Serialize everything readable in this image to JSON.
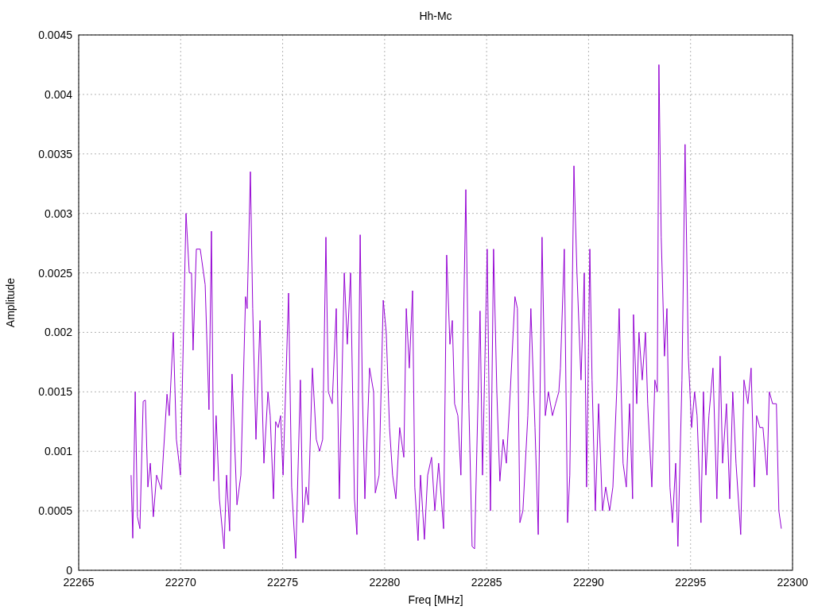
{
  "chart_data": {
    "type": "line",
    "grid": true,
    "title": "Hh-Mc",
    "xlabel": "Freq [MHz]",
    "ylabel": "Amplitude",
    "xlim": [
      22265,
      22300
    ],
    "ylim": [
      0,
      0.0045
    ],
    "xticks": [
      22265,
      22270,
      22275,
      22280,
      22285,
      22290,
      22295,
      22300
    ],
    "yticks": [
      0,
      0.0005,
      0.001,
      0.0015,
      0.002,
      0.0025,
      0.003,
      0.0035,
      0.004,
      0.0045
    ],
    "x": [
      22267.57,
      22267.65,
      22267.77,
      22267.88,
      22268.0,
      22268.16,
      22268.27,
      22268.39,
      22268.51,
      22268.66,
      22268.82,
      22269.05,
      22269.33,
      22269.44,
      22269.64,
      22269.79,
      22269.99,
      22270.26,
      22270.42,
      22270.53,
      22270.61,
      22270.77,
      22270.96,
      22271.2,
      22271.39,
      22271.51,
      22271.62,
      22271.74,
      22271.9,
      22272.13,
      22272.25,
      22272.4,
      22272.52,
      22272.76,
      22272.95,
      22273.18,
      22273.26,
      22273.42,
      22273.53,
      22273.69,
      22273.89,
      22274.08,
      22274.28,
      22274.39,
      22274.55,
      22274.66,
      22274.78,
      22274.9,
      22275.02,
      22275.29,
      22275.44,
      22275.64,
      22275.87,
      22275.99,
      22276.15,
      22276.26,
      22276.46,
      22276.65,
      22276.81,
      22276.96,
      22277.12,
      22277.24,
      22277.43,
      22277.63,
      22277.78,
      22278.02,
      22278.17,
      22278.33,
      22278.52,
      22278.64,
      22278.8,
      22278.91,
      22279.03,
      22279.26,
      22279.46,
      22279.54,
      22279.73,
      22279.93,
      22280.08,
      22280.24,
      22280.39,
      22280.55,
      22280.74,
      22280.94,
      22281.06,
      22281.21,
      22281.37,
      22281.48,
      22281.64,
      22281.76,
      22281.95,
      22282.11,
      22282.3,
      22282.46,
      22282.65,
      22282.89,
      22283.04,
      22283.2,
      22283.32,
      22283.43,
      22283.59,
      22283.74,
      22283.98,
      22284.13,
      22284.29,
      22284.41,
      22284.68,
      22284.8,
      22285.03,
      22285.19,
      22285.34,
      22285.5,
      22285.65,
      22285.81,
      22285.97,
      22286.16,
      22286.39,
      22286.51,
      22286.63,
      22286.78,
      22287.02,
      22287.17,
      22287.37,
      22287.53,
      22287.72,
      22287.88,
      22288.03,
      22288.23,
      22288.38,
      22288.54,
      22288.62,
      22288.81,
      22288.97,
      22289.08,
      22289.28,
      22289.43,
      22289.63,
      22289.79,
      22289.9,
      22290.06,
      22290.17,
      22290.33,
      22290.49,
      22290.68,
      22290.84,
      22291.03,
      22291.19,
      22291.38,
      22291.5,
      22291.69,
      22291.85,
      22292.01,
      22292.16,
      22292.2,
      22292.36,
      22292.47,
      22292.63,
      22292.79,
      22292.9,
      22293.1,
      22293.25,
      22293.37,
      22293.45,
      22293.56,
      22293.72,
      22293.84,
      22293.99,
      22294.11,
      22294.27,
      22294.38,
      22294.58,
      22294.73,
      22294.89,
      22295.05,
      22295.2,
      22295.32,
      22295.51,
      22295.63,
      22295.75,
      22295.9,
      22296.1,
      22296.29,
      22296.45,
      22296.57,
      22296.76,
      22296.92,
      22297.07,
      22297.23,
      22297.46,
      22297.62,
      22297.81,
      22297.97,
      22298.13,
      22298.24,
      22298.4,
      22298.55,
      22298.75,
      22298.86,
      22299.02,
      22299.21,
      22299.33,
      22299.45
    ],
    "series": [
      {
        "color": "#9400d3",
        "values": [
          0.0008,
          0.00027,
          0.0015,
          0.00045,
          0.00035,
          0.00142,
          0.00143,
          0.0007,
          0.0009,
          0.00045,
          0.0008,
          0.00068,
          0.00148,
          0.0013,
          0.002,
          0.0011,
          0.0008,
          0.003,
          0.0025,
          0.0025,
          0.00185,
          0.0027,
          0.0027,
          0.0024,
          0.00135,
          0.00285,
          0.00075,
          0.0013,
          0.0006,
          0.00018,
          0.0008,
          0.00033,
          0.00165,
          0.00055,
          0.0008,
          0.0023,
          0.0022,
          0.00335,
          0.0022,
          0.0011,
          0.0021,
          0.0009,
          0.0015,
          0.0013,
          0.0006,
          0.00125,
          0.0012,
          0.0013,
          0.0008,
          0.00233,
          0.0007,
          0.0001,
          0.0016,
          0.0004,
          0.0007,
          0.00055,
          0.0017,
          0.0011,
          0.001,
          0.0011,
          0.0028,
          0.0015,
          0.0014,
          0.0022,
          0.0006,
          0.0025,
          0.0019,
          0.0025,
          0.0006,
          0.0003,
          0.00282,
          0.0015,
          0.0006,
          0.0017,
          0.0015,
          0.00065,
          0.0008,
          0.00227,
          0.002,
          0.0012,
          0.0008,
          0.0006,
          0.0012,
          0.00095,
          0.0022,
          0.0017,
          0.00235,
          0.0007,
          0.00025,
          0.0008,
          0.00026,
          0.0008,
          0.00095,
          0.0005,
          0.0009,
          0.00035,
          0.00265,
          0.0019,
          0.0021,
          0.0014,
          0.0013,
          0.0008,
          0.0032,
          0.0014,
          0.0002,
          0.00018,
          0.00218,
          0.0008,
          0.0027,
          0.0005,
          0.0027,
          0.0015,
          0.00075,
          0.0011,
          0.0009,
          0.0015,
          0.0023,
          0.0022,
          0.0004,
          0.0005,
          0.0013,
          0.0022,
          0.0012,
          0.0003,
          0.0028,
          0.0013,
          0.0015,
          0.0013,
          0.0014,
          0.0015,
          0.0017,
          0.0027,
          0.0004,
          0.0008,
          0.0034,
          0.0025,
          0.0016,
          0.0025,
          0.0007,
          0.0027,
          0.0016,
          0.0005,
          0.0014,
          0.0005,
          0.0007,
          0.0005,
          0.0007,
          0.0015,
          0.0022,
          0.0009,
          0.0007,
          0.0014,
          0.0006,
          0.00215,
          0.0014,
          0.002,
          0.0016,
          0.002,
          0.0014,
          0.0007,
          0.0016,
          0.0015,
          0.00425,
          0.0028,
          0.0018,
          0.0022,
          0.0007,
          0.0004,
          0.0009,
          0.0002,
          0.0016,
          0.00358,
          0.0018,
          0.0012,
          0.0015,
          0.0013,
          0.0004,
          0.0015,
          0.0008,
          0.0013,
          0.0017,
          0.0006,
          0.0018,
          0.0009,
          0.0014,
          0.0006,
          0.0015,
          0.0009,
          0.0003,
          0.0016,
          0.0014,
          0.0017,
          0.0007,
          0.0013,
          0.0012,
          0.0012,
          0.0008,
          0.0015,
          0.0014,
          0.0014,
          0.0005,
          0.00035
        ]
      }
    ]
  }
}
